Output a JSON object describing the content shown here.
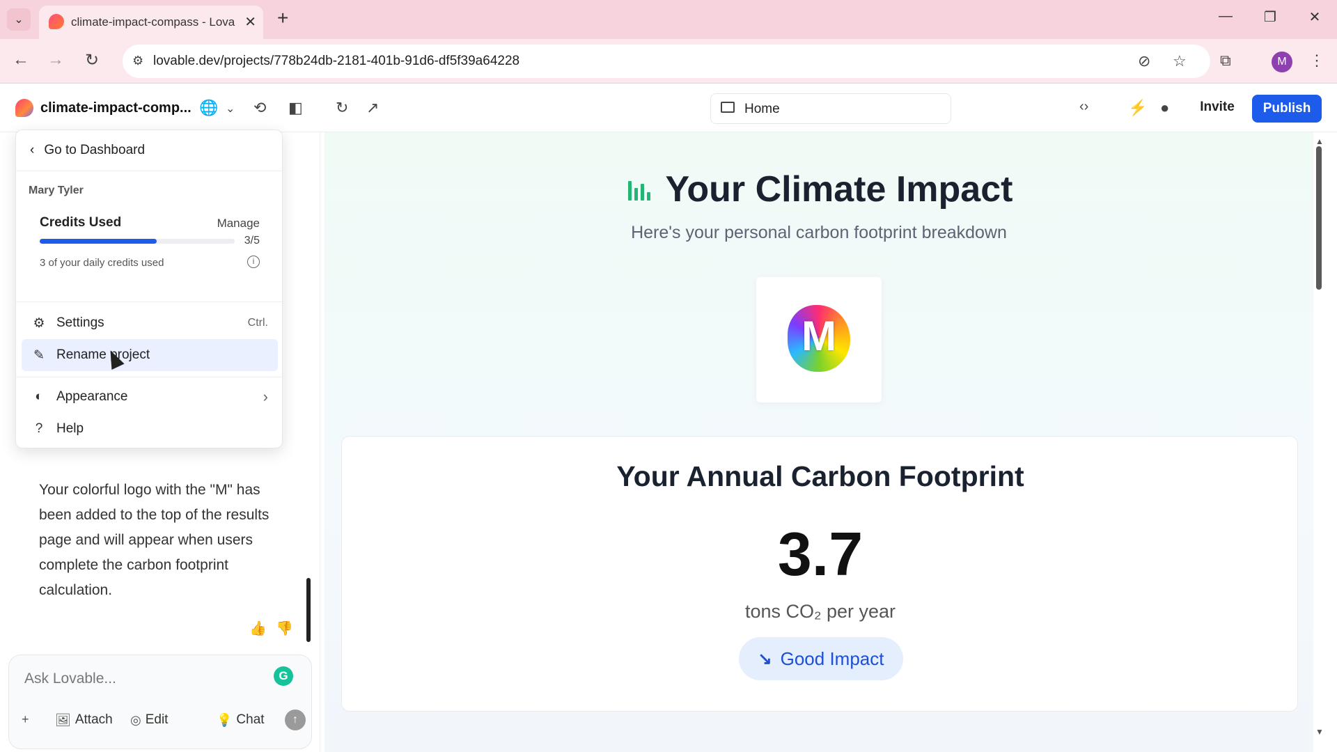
{
  "browser": {
    "tab_title": "climate-impact-compass - Lova",
    "url": "lovable.dev/projects/778b24db-2181-401b-91d6-df5f39a64228",
    "profile_initial": "M"
  },
  "header": {
    "project_name": "climate-impact-comp...",
    "page_select": "Home",
    "invite_label": "Invite",
    "publish_label": "Publish"
  },
  "menu": {
    "back_label": "Go to Dashboard",
    "user_name": "Mary Tyler",
    "credits": {
      "title": "Credits Used",
      "manage_label": "Manage",
      "count": "3/5",
      "used_fraction": 0.6,
      "note": "3 of your daily credits used"
    },
    "items": [
      {
        "label": "Settings",
        "shortcut": "Ctrl."
      },
      {
        "label": "Rename project"
      },
      {
        "label": "Appearance"
      },
      {
        "label": "Help"
      }
    ]
  },
  "chat": {
    "message": "Your colorful logo with the \"M\" has been added to the top of the results page and will appear when users complete the carbon footprint calculation.",
    "input_placeholder": "Ask Lovable...",
    "tools": {
      "attach": "Attach",
      "edit": "Edit",
      "chat": "Chat"
    }
  },
  "preview": {
    "title": "Your Climate Impact",
    "subtitle": "Here's your personal carbon footprint breakdown",
    "logo_letter": "M",
    "card": {
      "title": "Your Annual Carbon Footprint",
      "value": "3.7",
      "unit": "tons CO₂ per year",
      "badge": "Good Impact"
    }
  },
  "colors": {
    "accent": "#1d5bea",
    "chart_icon": "#22b573",
    "badge_text": "#1d4ed8"
  }
}
